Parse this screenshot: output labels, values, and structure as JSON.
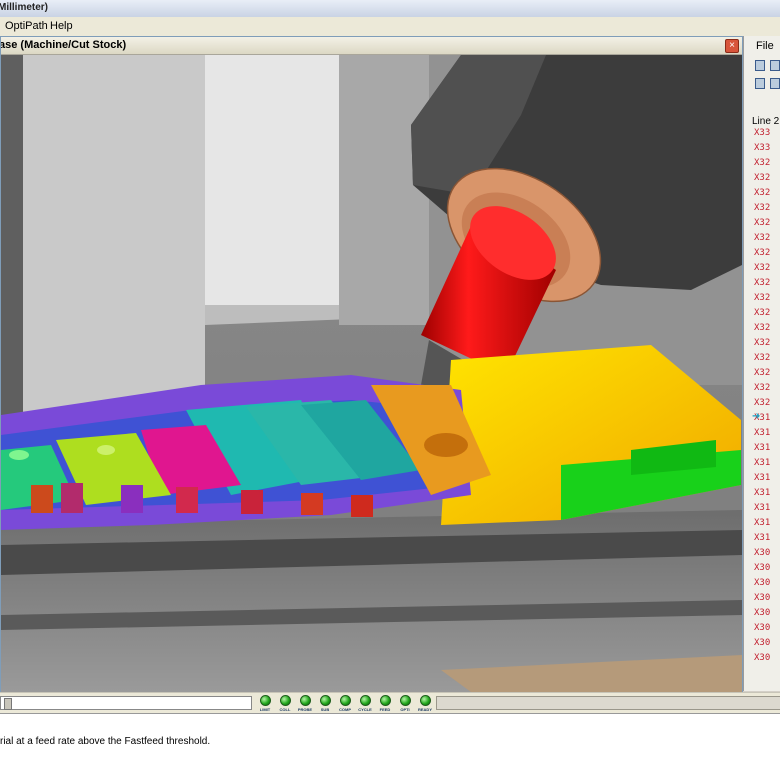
{
  "window": {
    "title": "Millimeter)"
  },
  "menu": {
    "items": [
      "OptiPath",
      "Help"
    ]
  },
  "viewport": {
    "title": "ase (Machine/Cut Stock)",
    "close_glyph": "×"
  },
  "right_panel": {
    "menu_file": "File",
    "line_label": "Line 2",
    "code_lines": [
      "X33",
      "X33",
      "X32",
      "X32",
      "X32",
      "X32",
      "X32",
      "X32",
      "X32",
      "X32",
      "X32",
      "X32",
      "X32",
      "X32",
      "X32",
      "X32",
      "X32",
      "X32",
      "X32",
      "X31",
      "X31",
      "X31",
      "X31",
      "X31",
      "X31",
      "X31",
      "X31",
      "X31",
      "X30",
      "X30",
      "X30",
      "X30",
      "X30",
      "X30",
      "X30",
      "X30"
    ],
    "current_line_index": 19,
    "arrow_glyph": "➔"
  },
  "indicators": [
    "LIMIT",
    "COLL",
    "PROBE",
    "SUB",
    "COMP",
    "CYCLE",
    "FEED",
    "OPTI",
    "READY"
  ],
  "status": {
    "message": "rial at a feed rate above the Fastfeed threshold."
  },
  "colors": {
    "accent_green": "#23a81e",
    "spindle_red": "#e30000",
    "code_red": "#c21f2e"
  }
}
